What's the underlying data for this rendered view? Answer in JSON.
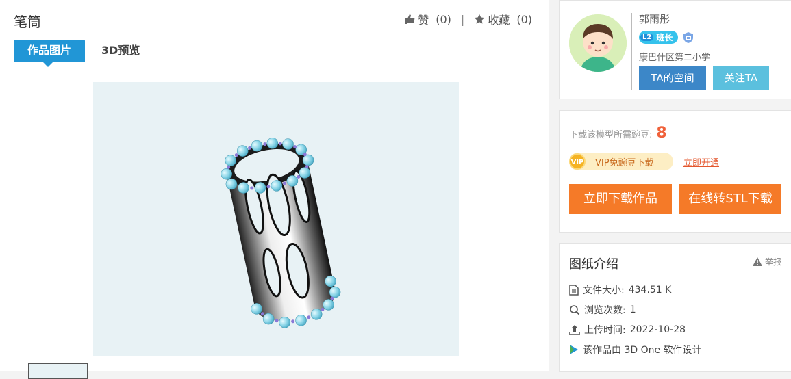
{
  "work": {
    "title": "笔筒"
  },
  "actions": {
    "like_label": "赞",
    "like_count": "(0)",
    "separator": "|",
    "fav_label": "收藏",
    "fav_count": "(0)"
  },
  "tabs": [
    {
      "label": "作品图片",
      "active": true
    },
    {
      "label": "3D预览",
      "active": false
    }
  ],
  "author": {
    "name": "郭雨彤",
    "level_code": "L2",
    "level_label": "班长",
    "school": "康巴什区第二小学",
    "space_button": "TA的空间",
    "follow_button": "关注TA"
  },
  "download": {
    "cost_label": "下载该模型所需豌豆:",
    "cost_value": "8",
    "vip_icon_text": "VIP",
    "vip_text": "VIP免豌豆下载",
    "vip_link": "立即开通",
    "download_button": "立即下载作品",
    "stl_button": "在线转STL下载"
  },
  "intro": {
    "title": "图纸介绍",
    "report": "举报",
    "file_size_label": "文件大小:",
    "file_size": "434.51 K",
    "views_label": "浏览次数:",
    "views": "1",
    "upload_label": "上传时间:",
    "upload_date": "2022-10-28",
    "software_text": "该作品由 3D One 软件设计"
  },
  "colors": {
    "accent": "#2196d6",
    "download": "#f57a28",
    "space_btn": "#3c87c8",
    "follow_btn": "#5bc0de",
    "highlight": "#f0613a"
  },
  "icons": [
    "thumbs-up-icon",
    "star-icon",
    "vip-coin-icon",
    "warning-icon",
    "file-icon",
    "view-icon",
    "upload-icon",
    "software-icon",
    "badge-icon"
  ]
}
